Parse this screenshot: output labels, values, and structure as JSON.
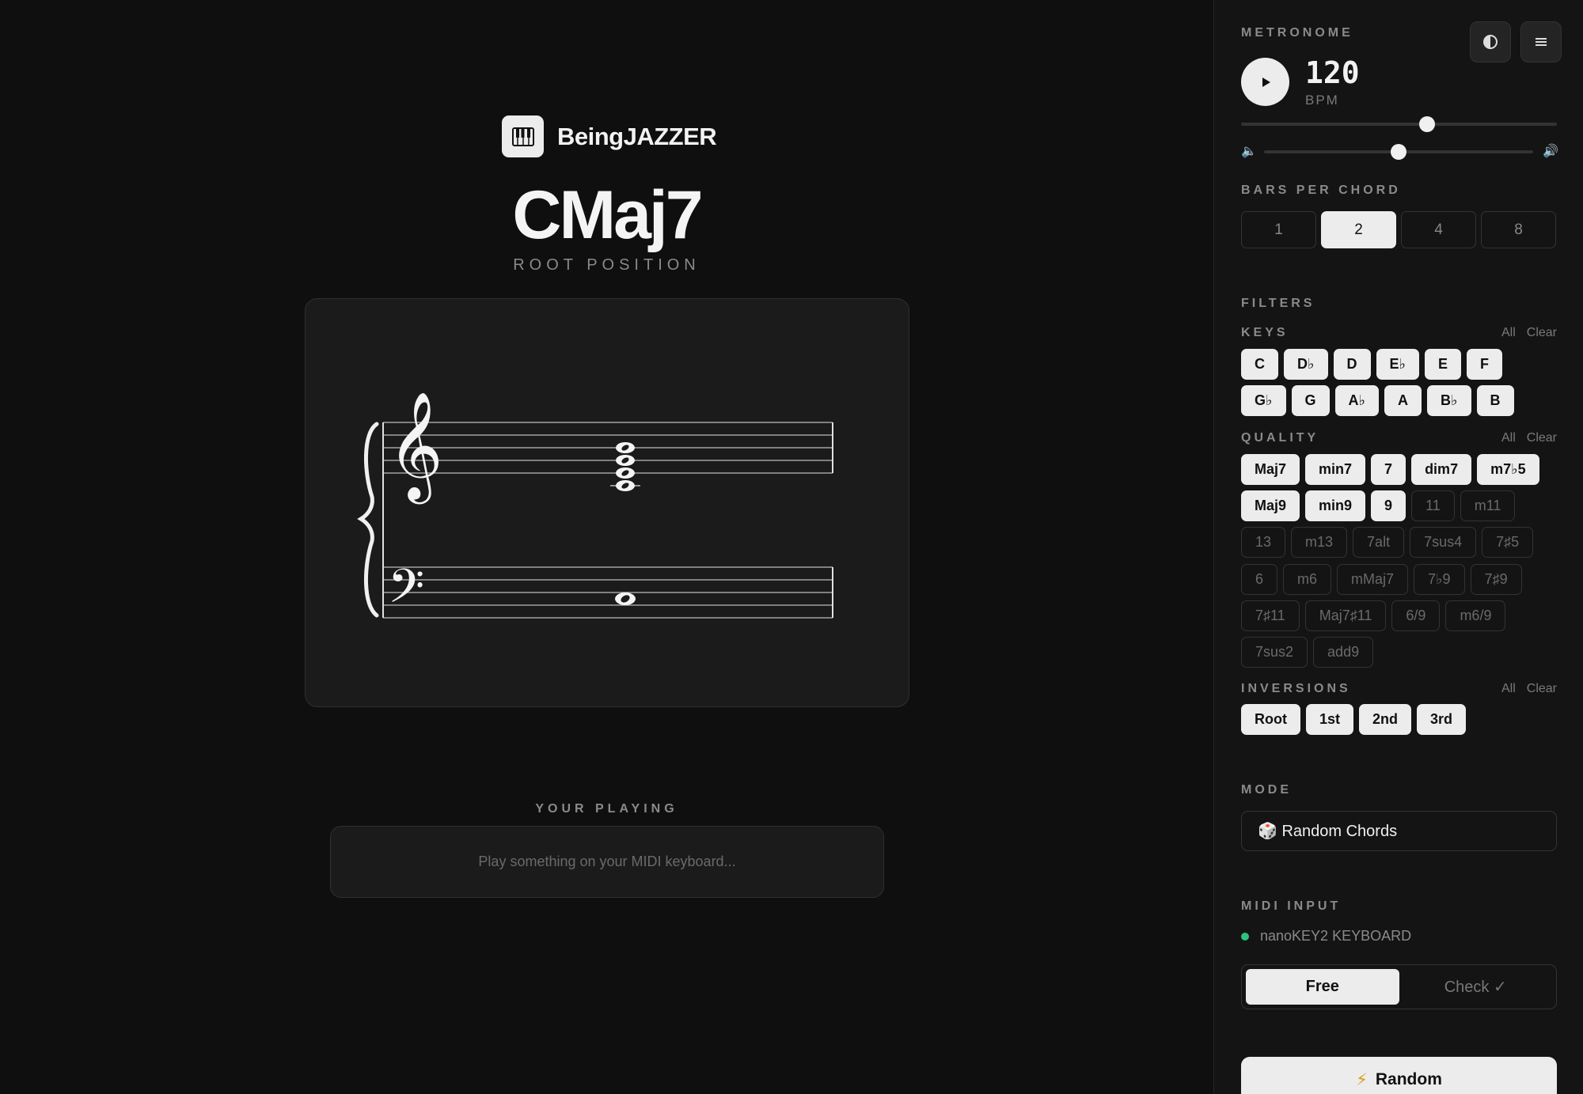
{
  "app": {
    "name": "BeingJAZZER"
  },
  "chord": {
    "name": "CMaj7",
    "position": "ROOT POSITION"
  },
  "playing": {
    "label": "YOUR PLAYING",
    "placeholder": "Play something on your MIDI keyboard..."
  },
  "metronome": {
    "title": "METRONOME",
    "bpm": "120",
    "bpm_unit": "BPM",
    "tempo_level": 0.59,
    "volume_level": 0.5
  },
  "bars_per_chord": {
    "title": "BARS PER CHORD",
    "options": [
      "1",
      "2",
      "4",
      "8"
    ],
    "selected": "2"
  },
  "filters": {
    "title": "FILTERS",
    "all_label": "All",
    "clear_label": "Clear",
    "keys": {
      "title": "KEYS",
      "items": [
        {
          "label": "C",
          "on": true
        },
        {
          "label": "D♭",
          "on": true
        },
        {
          "label": "D",
          "on": true
        },
        {
          "label": "E♭",
          "on": true
        },
        {
          "label": "E",
          "on": true
        },
        {
          "label": "F",
          "on": true
        },
        {
          "label": "G♭",
          "on": true
        },
        {
          "label": "G",
          "on": true
        },
        {
          "label": "A♭",
          "on": true
        },
        {
          "label": "A",
          "on": true
        },
        {
          "label": "B♭",
          "on": true
        },
        {
          "label": "B",
          "on": true
        }
      ]
    },
    "quality": {
      "title": "QUALITY",
      "items": [
        {
          "label": "Maj7",
          "on": true
        },
        {
          "label": "min7",
          "on": true
        },
        {
          "label": "7",
          "on": true
        },
        {
          "label": "dim7",
          "on": true
        },
        {
          "label": "m7♭5",
          "on": true
        },
        {
          "label": "Maj9",
          "on": true
        },
        {
          "label": "min9",
          "on": true
        },
        {
          "label": "9",
          "on": true
        },
        {
          "label": "11",
          "on": false
        },
        {
          "label": "m11",
          "on": false
        },
        {
          "label": "13",
          "on": false
        },
        {
          "label": "m13",
          "on": false
        },
        {
          "label": "7alt",
          "on": false
        },
        {
          "label": "7sus4",
          "on": false
        },
        {
          "label": "7♯5",
          "on": false
        },
        {
          "label": "6",
          "on": false
        },
        {
          "label": "m6",
          "on": false
        },
        {
          "label": "mMaj7",
          "on": false
        },
        {
          "label": "7♭9",
          "on": false
        },
        {
          "label": "7♯9",
          "on": false
        },
        {
          "label": "7♯11",
          "on": false
        },
        {
          "label": "Maj7♯11",
          "on": false
        },
        {
          "label": "6/9",
          "on": false
        },
        {
          "label": "m6/9",
          "on": false
        },
        {
          "label": "7sus2",
          "on": false
        },
        {
          "label": "add9",
          "on": false
        }
      ]
    },
    "inversions": {
      "title": "INVERSIONS",
      "items": [
        {
          "label": "Root",
          "on": true
        },
        {
          "label": "1st",
          "on": true
        },
        {
          "label": "2nd",
          "on": true
        },
        {
          "label": "3rd",
          "on": true
        }
      ]
    }
  },
  "mode": {
    "title": "MODE",
    "value": "🎲 Random Chords"
  },
  "midi": {
    "title": "MIDI INPUT",
    "device": "nanoKEY2 KEYBOARD",
    "status_color": "#2ec27e",
    "options": [
      "Free",
      "Check ✓"
    ],
    "selected": "Free"
  },
  "random_button": {
    "label": "Random",
    "icon": "lightning-icon"
  },
  "colors": {
    "accent": "#ececec",
    "background": "#0f0f0f",
    "sidebar": "#141414",
    "status_ok": "#2ec27e"
  }
}
